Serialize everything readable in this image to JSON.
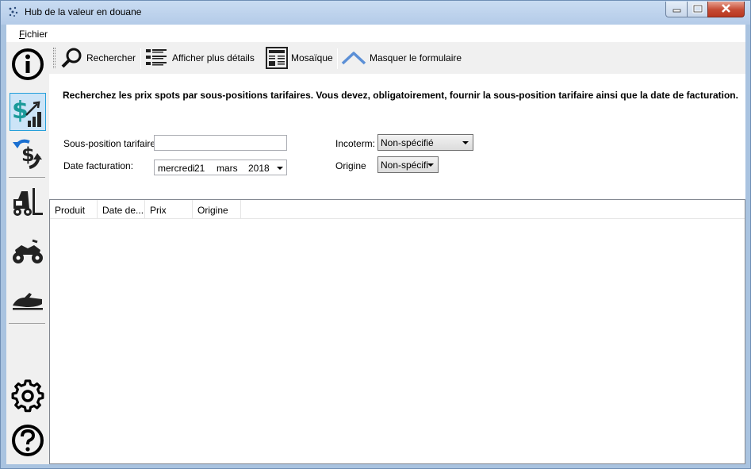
{
  "window": {
    "title": "Hub de la valeur en douane"
  },
  "menu": {
    "file_prefix": "F",
    "file_rest": "ichier"
  },
  "sidebar": {
    "items": [
      {
        "icon": "info-icon"
      },
      {
        "icon": "dollar-chart-icon",
        "active": true
      },
      {
        "icon": "currency-exchange-icon"
      },
      {
        "icon": "forklift-icon"
      },
      {
        "icon": "atv-icon"
      },
      {
        "icon": "jetski-icon"
      },
      {
        "icon": "gear-icon"
      },
      {
        "icon": "help-icon"
      }
    ]
  },
  "toolbar": {
    "search_label": "Rechercher",
    "details_label": "Afficher plus détails",
    "mosaic_label": "Mosaïque",
    "hide_form_label": "Masquer le formulaire"
  },
  "form": {
    "instruction": "Recherchez les prix spots par sous-positions tarifaires. Vous devez, obligatoirement, fournir la sous-position tarifaire ainsi que la date de facturation.",
    "tariff_label": "Sous-position tarifaire:",
    "tariff_value": "",
    "date_label": "Date facturation:",
    "date_weekday": "mercredi",
    "date_day": "21",
    "date_month": "mars",
    "date_year": "2018",
    "incoterm_label": "Incoterm:",
    "incoterm_value": "Non-spécifié",
    "origin_label": "Origine",
    "origin_value": "Non-spécifi"
  },
  "results": {
    "columns": [
      "Produit",
      "Date de...",
      "Prix",
      "Origine"
    ]
  },
  "colors": {
    "accent": "#26a0da",
    "dollar_green": "#1a9a9a",
    "window_frame": "#a9c3e0"
  }
}
